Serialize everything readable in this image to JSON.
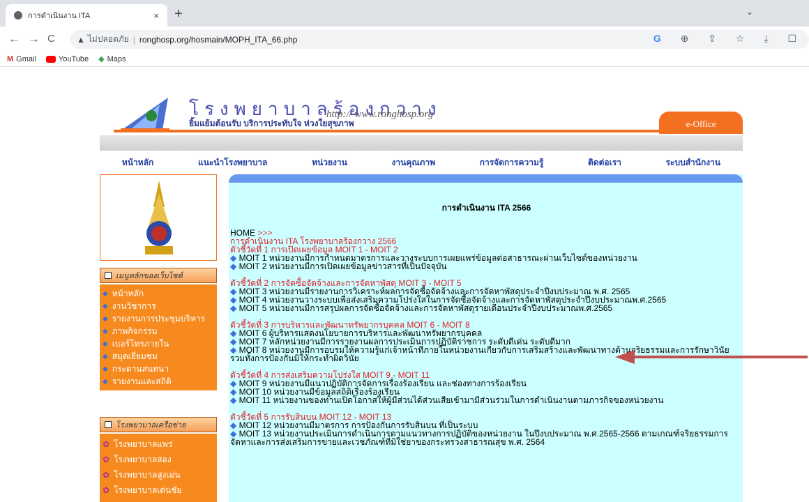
{
  "browser": {
    "tab_title": "การดำเนินงาน ITA",
    "tab_close": "×",
    "new_tab": "+",
    "tab_menu": "⌄",
    "security_label": "ไม่ปลอดภัย",
    "url": "ronghosp.org/hosmain/MOPH_ITA_66.php",
    "nav_back": "←",
    "nav_forward": "→",
    "nav_reload": "C",
    "omnibox_icons": [
      "G",
      "⊕",
      "⇪",
      "☆",
      "⤓",
      "☐"
    ],
    "bookmarks": [
      "Gmail",
      "YouTube",
      "Maps"
    ]
  },
  "site": {
    "title": "โรงพยาบาลร้องกวาง",
    "slogan": "ยิ้มแย้มต้อนรับ บริการประทับใจ ห่วงใยสุขภาพ",
    "url": "http:// www.ronghosp.org",
    "eoffice": "e-Office",
    "menu": [
      "หน้าหลัก",
      "แนะนำโรงพยาบาล",
      "หน่วยงาน",
      "งานคุณภาพ",
      "การจัดการความรู้",
      "ติดต่อเรา",
      "ระบบสำนักงาน"
    ]
  },
  "sidebar": {
    "section1": "เมนูหลักของเว็บไซต์",
    "items": [
      "หน้าหลัก",
      "งานวิชาการ",
      "รายงานการประชุมบริหาร",
      "ภาพกิจกรรม",
      "เบอร์โทรภายใน",
      "สมุดเยี่ยมชม",
      "กระดานสนทนา",
      "รายงานและสถิติ"
    ],
    "section2": "โรงพยาบาลเครือข่าย",
    "hospitals": [
      "โรงพยาบาลแพร่",
      "โรงพยาบาลสอง",
      "โรงพยาบาลสูงเม่น",
      "โรงพยาบาลเด่นชัย"
    ]
  },
  "content": {
    "title": "การดำเนินงาน ITA 2566",
    "home": "HOME",
    "home_arrow": ">>>",
    "subtitle": "การดำเนินงาน ITA โรงพยาบาลร้องกวาง 2566",
    "groups": [
      {
        "heading": "ตัวชี้วัดที่ 1 การเปิดเผยข้อมูล MOIT 1 - MOIT 2",
        "items": [
          "MOIT 1 หน่วยงานมีการกำหนดมาตรการและวางระบบการเผยแพร่ข้อมูลต่อสาธารณะผ่านเว็บไซต์ของหน่วยงาน",
          "MOIT 2 หน่วยงานมีการเปิดเผยข้อมูลข่าวสารที่เป็นปัจจุบัน"
        ]
      },
      {
        "heading": "ตัวชี้วัดที่ 2 การจัดซื้อจัดจ้างและการจัดหาพัสดุ MOIT 3 - MOIT 5",
        "items": [
          "MOIT 3 หน่วยงานมีรายงานการวิเคราะห์ผลการจัดซื้อจัดจ้างและการจัดหาพัสดุประจำปีงบประมาณ พ.ศ. 2565",
          "MOIT 4 หน่วยงานวางระบบเพื่อส่งเสริมความโปร่งใสในการจัดซื้อจัดจ้างและการจัดหาพัสดุประจำปีงบประมาณพ.ศ.2565",
          "MOIT 5 หน่วยงานมีการสรุปผลการจัดซื้อจัดจ้างและการจัดหาพัสดุรายเดือนประจำปีงบประมาณพ.ศ.2565"
        ]
      },
      {
        "heading": "ตัวชี้วัดที่ 3 การบริหารและพัฒนาทรัพยากรบุคคล MOIT 6 - MOIT 8",
        "items": [
          "MOIT 6 ผู้บริหารแสดงนโยบายการบริหารและพัฒนาทรัพยากรบุคคล",
          "MOIT 7 หลักหน่วยงานมีการรายงานผลการประเมินการปฏิบัติราชการ ระดับดีเด่น ระดับดีมาก",
          "MOIT 8 หน่วยงานมีการอบรมให้ความรู้แก่เจ้าหน้าที่ภายในหน่วยงานเกี่ยวกับการเสริมสร้างและพัฒนาทางด้านจริยธรรมและการรักษาวินัยรวมทั้งการป้องกันมิให้กระทำผิดวินัย"
        ]
      },
      {
        "heading": "ตัวชี้วัดที่ 4 การส่งเสริมความโปร่งใส MOIT 9 - MOIT 11",
        "items": [
          "MOIT 9 หน่วยงานมีแนวปฏิบัติการจัดการเรื่องร้องเรียน และช่องทางการร้องเรียน",
          "MOIT 10 หน่วยงานมีข้อมูลสถิติเรื่องร้องเรียน",
          "MOIT 11 หน่วยงานของท่านเปิดโอกาสให้ผู้มีส่วนได้ส่วนเสียเข้ามามีส่วนร่วมในการดำเนินงานตามภารกิจของหน่วยงาน"
        ]
      },
      {
        "heading": "ตัวชี้วัดที่ 5 การรับสินบน MOIT 12 - MOIT 13",
        "items": [
          "MOIT 12 หน่วยงานมีมาตรการ การป้องกันการรับสินบน ที่เป็นระบบ",
          "MOIT 13 หน่วยงานประเมินการดำเนินการตามแนวทางการปฏิบัติของหน่วยงาน ในปีงบประมาณ พ.ศ.2565-2566 ตามเกณฑ์จริยธรรมการจัดหาและการส่งเสริมการขายและเวชภัณฑ์ที่มิใช่ยาของกระทรวงสาธารณสุข พ.ศ. 2564"
        ]
      }
    ]
  }
}
